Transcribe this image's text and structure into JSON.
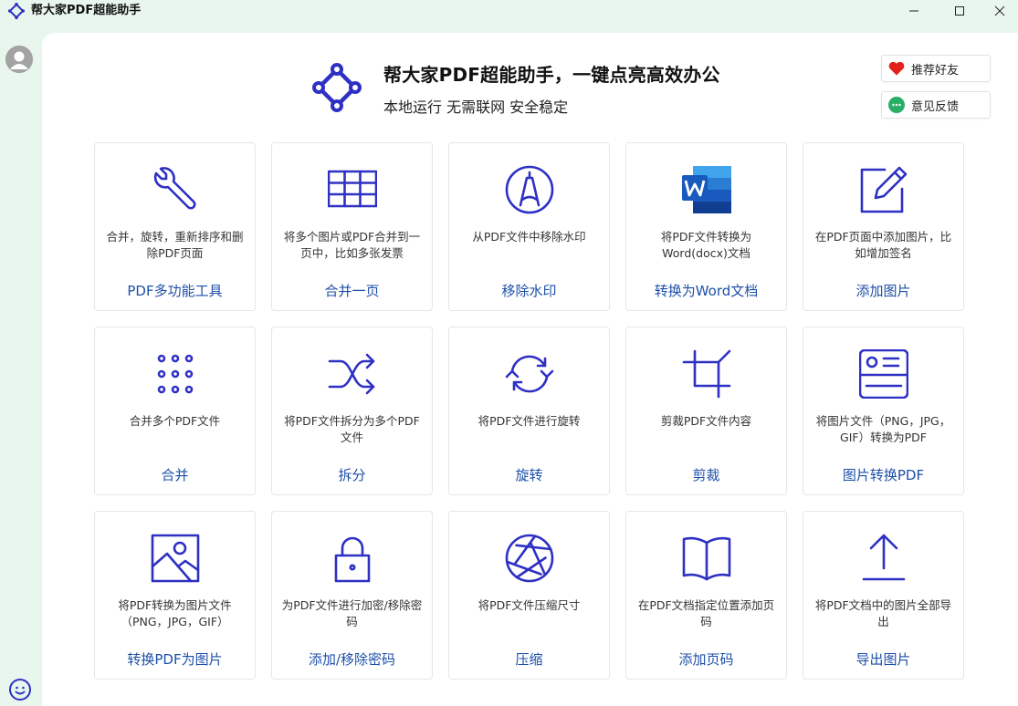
{
  "window": {
    "title": "帮大家PDF超能助手"
  },
  "header": {
    "title": "帮大家PDF超能助手，一键点亮高效办公",
    "subtitle": "本地运行 无需联网 安全稳定",
    "recommend_label": "推荐好友",
    "feedback_label": "意见反馈"
  },
  "colors": {
    "accent": "#2e30c4",
    "title_blue": "#1d4fa8",
    "rail_bg": "#e8f6ee"
  },
  "cards": [
    {
      "icon": "wrench-icon",
      "desc": "合并，旋转，重新排序和删除PDF页面",
      "title": "PDF多功能工具"
    },
    {
      "icon": "grid-table-icon",
      "desc": "将多个图片或PDF合并到一页中，比如多张发票",
      "title": "合并一页"
    },
    {
      "icon": "watermark-icon",
      "desc": "从PDF文件中移除水印",
      "title": "移除水印"
    },
    {
      "icon": "word-icon",
      "desc": "将PDF文件转换为Word(docx)文档",
      "title": "转换为Word文档"
    },
    {
      "icon": "edit-icon",
      "desc": "在PDF页面中添加图片，比如增加签名",
      "title": "添加图片"
    },
    {
      "icon": "dots-grid-icon",
      "desc": "合并多个PDF文件",
      "title": "合并"
    },
    {
      "icon": "shuffle-icon",
      "desc": "将PDF文件拆分为多个PDF文件",
      "title": "拆分"
    },
    {
      "icon": "rotate-icon",
      "desc": "将PDF文件进行旋转",
      "title": "旋转"
    },
    {
      "icon": "crop-icon",
      "desc": "剪裁PDF文件内容",
      "title": "剪裁"
    },
    {
      "icon": "image-card-icon",
      "desc": "将图片文件（PNG，JPG，GIF）转换为PDF",
      "title": "图片转换PDF"
    },
    {
      "icon": "picture-icon",
      "desc": "将PDF转换为图片文件（PNG，JPG，GIF）",
      "title": "转换PDF为图片"
    },
    {
      "icon": "lock-icon",
      "desc": "为PDF文件进行加密/移除密码",
      "title": "添加/移除密码"
    },
    {
      "icon": "aperture-icon",
      "desc": "将PDF文件压缩尺寸",
      "title": "压缩"
    },
    {
      "icon": "book-icon",
      "desc": "在PDF文档指定位置添加页码",
      "title": "添加页码"
    },
    {
      "icon": "upload-icon",
      "desc": "将PDF文档中的图片全部导出",
      "title": "导出图片"
    }
  ]
}
